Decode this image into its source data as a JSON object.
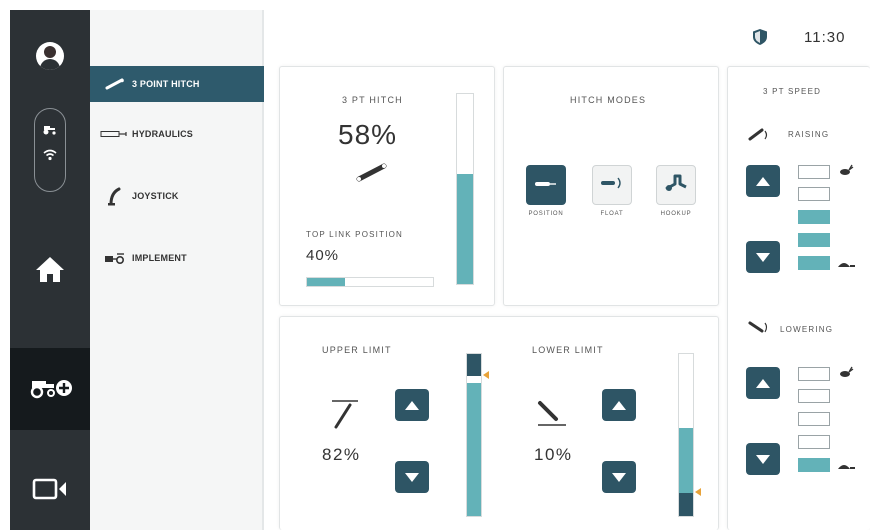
{
  "rail": {
    "icons": [
      "avatar-icon",
      "tractor-icon",
      "wifi-icon",
      "home-icon",
      "tractor-add-icon",
      "camera-icon"
    ]
  },
  "subnav": {
    "items": [
      {
        "label": "3 POINT HITCH",
        "icon": "hitch-icon",
        "selected": true
      },
      {
        "label": "HYDRAULICS",
        "icon": "hydraulics-icon",
        "selected": false
      },
      {
        "label": "JOYSTICK",
        "icon": "joystick-icon",
        "selected": false
      },
      {
        "label": "IMPLEMENT",
        "icon": "implement-icon",
        "selected": false
      }
    ]
  },
  "status": {
    "time": "11:30",
    "icon": "shield-icon"
  },
  "hitch": {
    "title": "3 PT HITCH",
    "percent": "58%",
    "level": 0.58,
    "top_link_label": "TOP LINK POSITION",
    "top_link_value": "40%",
    "top_link_level": 0.3
  },
  "modes": {
    "title": "HITCH MODES",
    "items": [
      {
        "label": "POSITION",
        "active": true
      },
      {
        "label": "FLOAT",
        "active": false
      },
      {
        "label": "HOOKUP",
        "active": false
      }
    ]
  },
  "limits": {
    "upper_label": "UPPER LIMIT",
    "upper_value": "82%",
    "upper_level": 0.82,
    "lower_label": "LOWER LIMIT",
    "lower_value": "10%",
    "lower_level": 0.1
  },
  "speed": {
    "title": "3 PT SPEED",
    "raising_label": "RAISING",
    "raising_levels": [
      false,
      false,
      true,
      true,
      true
    ],
    "lowering_label": "LOWERING",
    "lowering_levels": [
      false,
      false,
      false,
      false,
      true
    ]
  },
  "colors": {
    "accent": "#63b2b8",
    "navy": "#2e5565",
    "rail": "#2c3135",
    "selected": "#2e5a6c"
  }
}
